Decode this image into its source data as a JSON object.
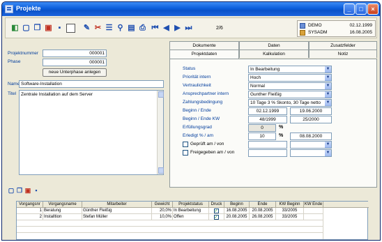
{
  "window": {
    "title": "Projekte"
  },
  "toolbar": {
    "counter": "2/6",
    "user": {
      "name1": "DEMO",
      "name2": "SYSADM",
      "date1": "02.12.1999",
      "date2": "16.08.2005"
    }
  },
  "left": {
    "projektnummer_label": "Projektnummer",
    "projektnummer_value": "000001",
    "phase_label": "Phase",
    "phase_value": "000001",
    "new_subphase_button": "neue Unterphase anlegen",
    "name_label": "Name",
    "name_value": "Software-Installation",
    "titel_label": "Titel",
    "titel_value": "Zentrale Installation auf dem Server"
  },
  "tabs": {
    "row1": [
      "Dokumente",
      "Daten",
      "Zusatzfelder"
    ],
    "row2": [
      "Projektdaten",
      "Kalkulation",
      "Notiz"
    ]
  },
  "projektdaten": {
    "status_label": "Status",
    "status_value": "In Bearbeitung",
    "prioritaet_label": "Priorität intern",
    "prioritaet_value": "Hoch",
    "vertraulichkeit_label": "Vertraulichkeit",
    "vertraulichkeit_value": "Normal",
    "ansprechpartner_label": "Ansprechpartner intern",
    "ansprechpartner_value": "Gunther Fleißig",
    "zahlung_label": "Zahlungsbedingung",
    "zahlung_value": "10 Tage 3 % Skonto, 30 Tage netto",
    "beginn_ende_label": "Beginn / Ende",
    "beginn_value": "02.12.1999",
    "ende_value": "19.06.2000",
    "beginn_ende_kw_label": "Beginn / Ende KW",
    "beginn_kw_value": "48/1999",
    "ende_kw_value": "25/2000",
    "erfuellungsgrad_label": "Erfüllungsgrad",
    "erfuellungsgrad_value": "0",
    "erfuellungsgrad_unit": "%",
    "erledigt_label": "Erledigt % / am",
    "erledigt_value": "10",
    "erledigt_unit": "%",
    "erledigt_date": "08.08.2000",
    "geprueft_label": "Geprüft am / von",
    "freigegeben_label": "Freigegeben am / von"
  },
  "grid": {
    "headers": [
      "Vorgangsnr",
      "Vorgangsname",
      "Mitarbeiter",
      "Gewicht",
      "Projektstatus",
      "Druck",
      "Beginn",
      "Ende",
      "KW Beginn",
      "KW Ende"
    ],
    "rows": [
      [
        "1",
        "Beratung",
        "Günther Fleißig",
        "20,0%",
        "In Bearbeitung",
        "",
        "16.08.2005",
        "20.08.2005",
        "33/2005",
        ""
      ],
      [
        "2",
        "Installtion",
        "Stefan Müller",
        "10,0%",
        "Offen",
        "",
        "20.08.2005",
        "26.08.2005",
        "33/2005",
        ""
      ]
    ]
  }
}
